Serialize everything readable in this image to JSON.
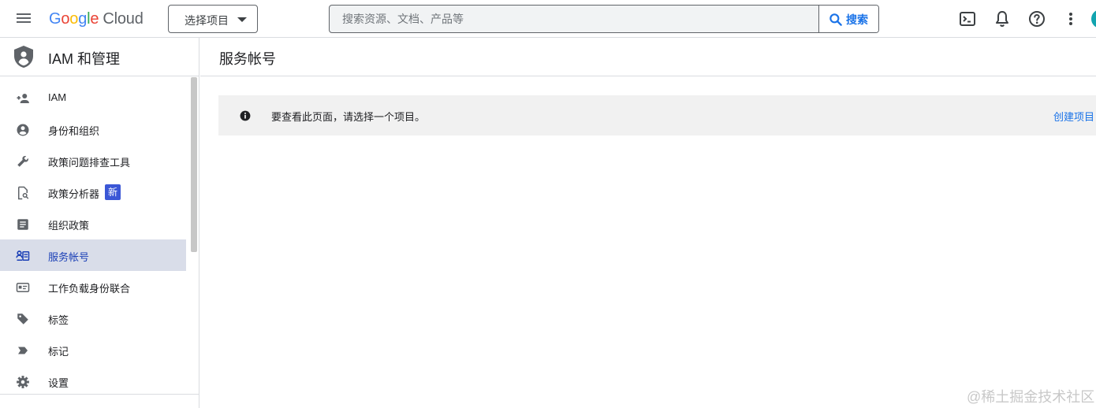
{
  "topbar": {
    "logo": {
      "letters": [
        "G",
        "o",
        "o",
        "g",
        "l",
        "e"
      ],
      "suffix": "Cloud"
    },
    "project_select_label": "选择项目",
    "search": {
      "placeholder": "搜索资源、文档、产品等",
      "value": "",
      "button_label": "搜索"
    },
    "icons": [
      "menu-icon",
      "cloud-shell-icon",
      "notifications-icon",
      "help-icon",
      "more-vert-icon",
      "avatar"
    ]
  },
  "sidebar": {
    "title": "IAM 和管理",
    "items": [
      {
        "label": "IAM",
        "icon": "person-add-icon"
      },
      {
        "label": "身份和组织",
        "icon": "account-circle-icon"
      },
      {
        "label": "政策问题排查工具",
        "icon": "wrench-icon"
      },
      {
        "label": "政策分析器",
        "icon": "policy-analyzer-icon",
        "badge": "新"
      },
      {
        "label": "组织政策",
        "icon": "list-document-icon"
      },
      {
        "label": "服务帐号",
        "icon": "service-account-icon",
        "active": true
      },
      {
        "label": "工作负载身份联合",
        "icon": "id-card-icon"
      },
      {
        "label": "标签",
        "icon": "tag-icon"
      },
      {
        "label": "标记",
        "icon": "label-icon"
      },
      {
        "label": "设置",
        "icon": "gear-icon"
      }
    ]
  },
  "main": {
    "title": "服务帐号",
    "notice": {
      "message": "要查看此页面，请选择一个项目。",
      "link": "创建项目"
    }
  },
  "watermark": "@稀土掘金技术社区",
  "colors": {
    "accent": "#1a73e8",
    "active_bg": "#d9dde9",
    "badge_bg": "#3b57d6",
    "avatar": "#12a4af"
  }
}
